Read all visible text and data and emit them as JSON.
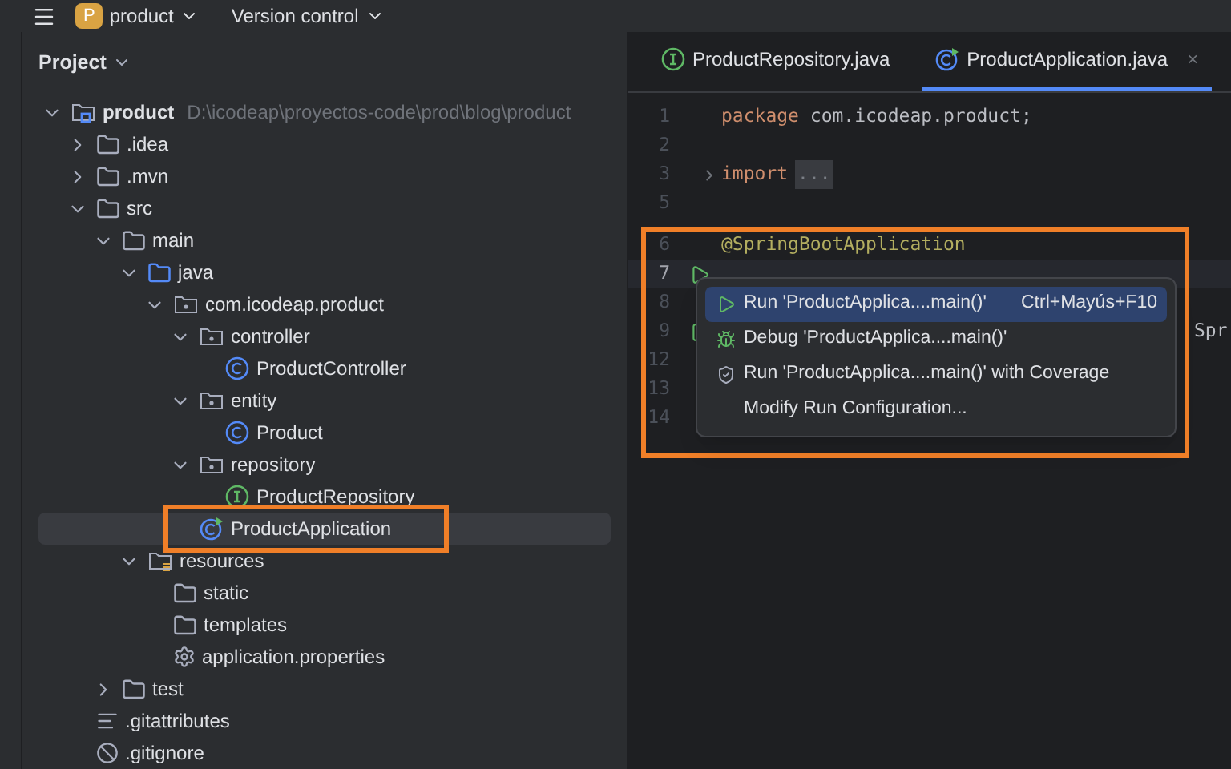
{
  "toolbar": {
    "project_badge": "P",
    "project": "product",
    "vcs": "Version control"
  },
  "project_panel": {
    "title": "Project",
    "tree": [
      {
        "name": "product",
        "path": "D:\\icodeap\\proyectos-code\\prod\\blog\\product",
        "kind": "module",
        "expanded": true,
        "selected": false,
        "children": [
          {
            "name": ".idea",
            "kind": "folder",
            "expanded": false,
            "selected": false
          },
          {
            "name": ".mvn",
            "kind": "folder",
            "expanded": false,
            "selected": false
          },
          {
            "name": "src",
            "kind": "folder",
            "expanded": true,
            "selected": false,
            "children": [
              {
                "name": "main",
                "kind": "folder",
                "expanded": true,
                "selected": false,
                "children": [
                  {
                    "name": "java",
                    "kind": "source",
                    "expanded": true,
                    "selected": false,
                    "children": [
                      {
                        "name": "com.icodeap.product",
                        "kind": "package",
                        "expanded": true,
                        "selected": false,
                        "children": [
                          {
                            "name": "controller",
                            "kind": "package",
                            "expanded": true,
                            "selected": false,
                            "children": [
                              {
                                "name": "ProductController",
                                "kind": "class",
                                "selected": false
                              }
                            ]
                          },
                          {
                            "name": "entity",
                            "kind": "package",
                            "expanded": true,
                            "selected": false,
                            "children": [
                              {
                                "name": "Product",
                                "kind": "class",
                                "selected": false
                              }
                            ]
                          },
                          {
                            "name": "repository",
                            "kind": "package",
                            "expanded": true,
                            "selected": false,
                            "children": [
                              {
                                "name": "ProductRepository",
                                "kind": "interface",
                                "selected": false
                              }
                            ]
                          },
                          {
                            "name": "ProductApplication",
                            "kind": "app",
                            "selected": true,
                            "highlighted": true
                          }
                        ]
                      }
                    ]
                  },
                  {
                    "name": "resources",
                    "kind": "resources",
                    "expanded": true,
                    "selected": false,
                    "children": [
                      {
                        "name": "static",
                        "kind": "plainfolder",
                        "selected": false
                      },
                      {
                        "name": "templates",
                        "kind": "plainfolder",
                        "selected": false
                      },
                      {
                        "name": "application.properties",
                        "kind": "gear",
                        "selected": false
                      }
                    ]
                  }
                ]
              },
              {
                "name": "test",
                "kind": "folder",
                "expanded": false,
                "selected": false
              }
            ]
          },
          {
            "name": ".gitattributes",
            "kind": "lines",
            "selected": false
          },
          {
            "name": ".gitignore",
            "kind": "ignore",
            "selected": false
          }
        ]
      }
    ]
  },
  "editor": {
    "tabs": [
      {
        "label": "ProductRepository.java",
        "kind": "interface",
        "selected": false
      },
      {
        "label": "ProductApplication.java",
        "kind": "app",
        "selected": true,
        "close": "×"
      }
    ],
    "lines": [
      {
        "number": "1",
        "kind": "package",
        "keyword": "package",
        "text": " com.icodeap.product;"
      },
      {
        "number": "2",
        "kind": "blank"
      },
      {
        "number": "3",
        "kind": "import",
        "keyword": "import",
        "fold": "..."
      },
      {
        "number": "5",
        "kind": "blank"
      },
      {
        "number": "6",
        "kind": "annotation",
        "text": "@SpringBootApplication"
      },
      {
        "number": "7",
        "kind": "run",
        "current": true
      },
      {
        "number": "8",
        "kind": "blank"
      },
      {
        "number": "9",
        "kind": "run",
        "tail": "Spr"
      },
      {
        "number": "12",
        "kind": "blank"
      },
      {
        "number": "13",
        "kind": "blank"
      },
      {
        "number": "14",
        "kind": "blank"
      }
    ],
    "popup": {
      "items": [
        {
          "label": "Run 'ProductApplica....main()'",
          "shortcut": "Ctrl+Mayús+F10",
          "kind": "run",
          "selected": true
        },
        {
          "label": "Debug 'ProductApplica....main()'",
          "kind": "debug",
          "selected": false
        },
        {
          "label": "Run 'ProductApplica....main()' with Coverage",
          "kind": "coverage",
          "selected": false
        },
        {
          "label": "Modify Run Configuration...",
          "kind": "plain",
          "selected": false
        }
      ]
    }
  }
}
